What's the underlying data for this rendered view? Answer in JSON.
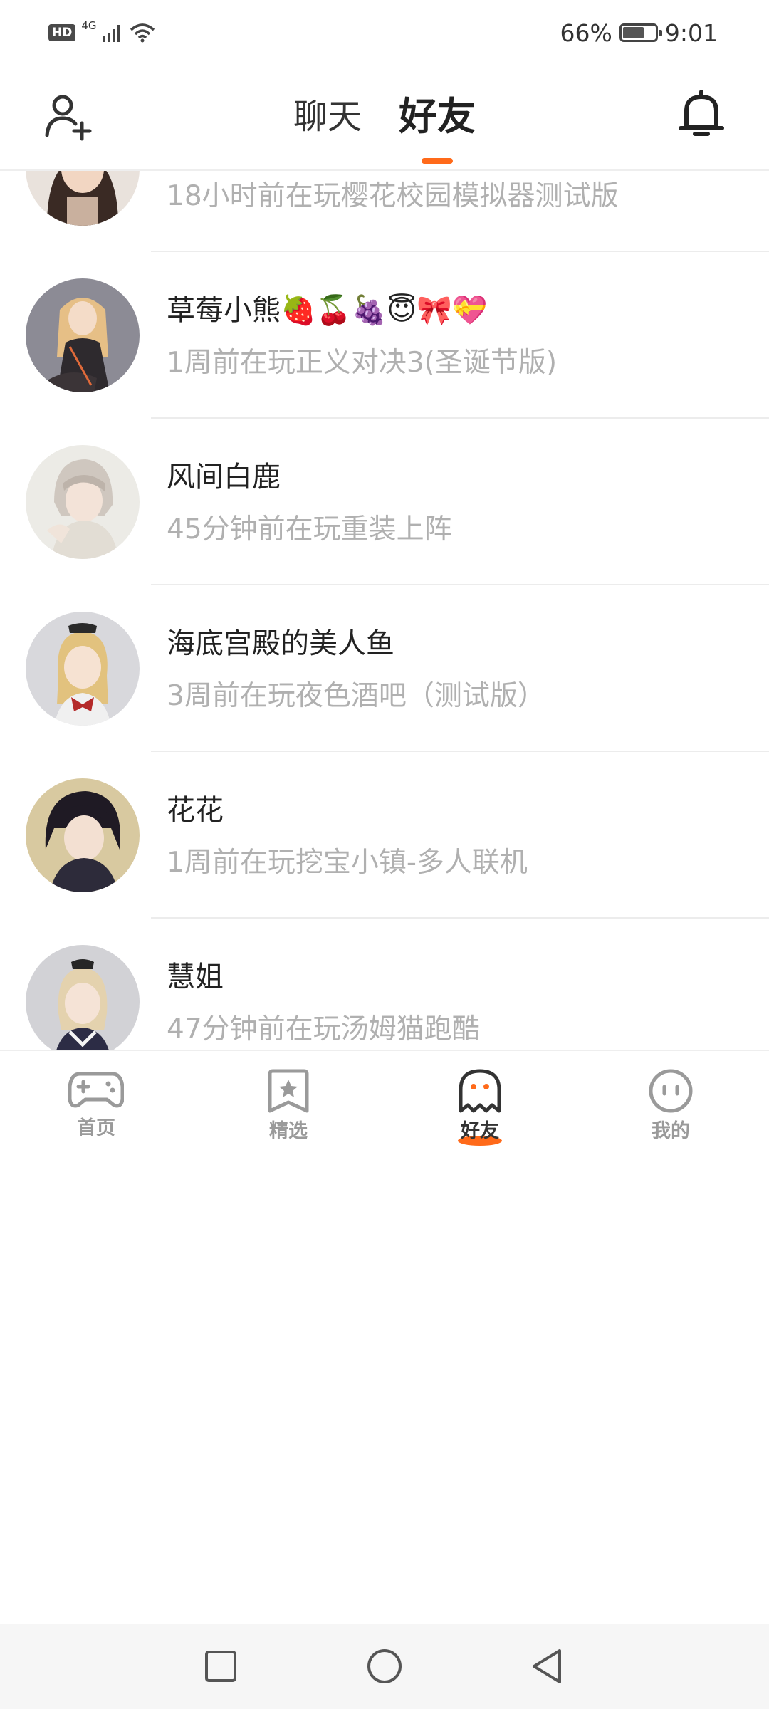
{
  "status_bar": {
    "hd_badge": "HD",
    "network": "4G",
    "battery_percent": "66%",
    "battery_level": 0.66,
    "time": "9:01"
  },
  "header": {
    "tabs": [
      {
        "label": "聊天",
        "active": false
      },
      {
        "label": "好友",
        "active": true
      }
    ],
    "accent_color": "#ff6a1a",
    "left_icon": "add-friend-icon",
    "right_icon": "bell-icon"
  },
  "friends": [
    {
      "name": "",
      "activity": "18小时前在玩樱花校园模拟器测试版",
      "avatar": "anime-girl-dark-hair"
    },
    {
      "name": "草莓小熊🍓🍒🍇😇🎀💝",
      "activity": "1周前在玩正义对决3(圣诞节版)",
      "avatar": "anime-girl-blonde"
    },
    {
      "name": "风间白鹿",
      "activity": "45分钟前在玩重装上阵",
      "avatar": "anime-boy-white-hair"
    },
    {
      "name": "海底宫殿的美人鱼",
      "activity": "3周前在玩夜色酒吧（测试版）",
      "avatar": "anime-girl-bow"
    },
    {
      "name": "花花",
      "activity": "1周前在玩挖宝小镇-多人联机",
      "avatar": "anime-boy-black-hair"
    },
    {
      "name": "慧姐",
      "activity": "47分钟前在玩汤姆猫跑酷",
      "avatar": "anime-girl-sailor"
    }
  ],
  "bottom_nav": [
    {
      "label": "首页",
      "icon": "gamepad-icon",
      "active": false
    },
    {
      "label": "精选",
      "icon": "bookmark-star-icon",
      "active": false
    },
    {
      "label": "好友",
      "icon": "ghost-icon",
      "active": true
    },
    {
      "label": "我的",
      "icon": "face-icon",
      "active": false
    }
  ],
  "system_nav": [
    "recents-square-icon",
    "home-circle-icon",
    "back-triangle-icon"
  ]
}
